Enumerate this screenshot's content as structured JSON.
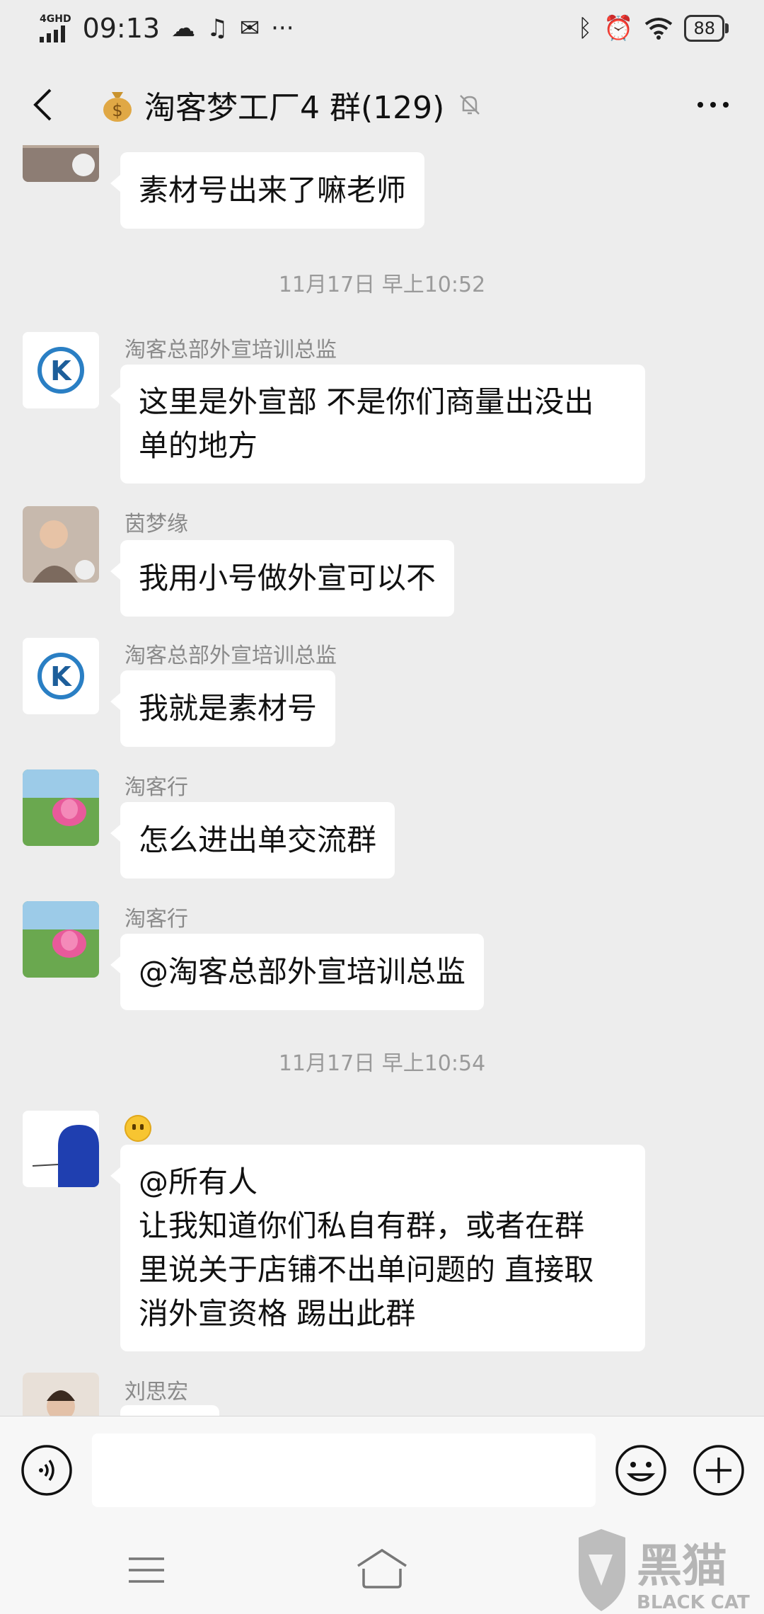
{
  "status_bar": {
    "network": "4GHD",
    "time": "09:13",
    "battery": "88"
  },
  "header": {
    "title": "淘客梦工厂4 群(129)"
  },
  "chat": {
    "partial_message": "素材号出来了嘛老师",
    "timestamp_1": "11月17日 早上10:52",
    "messages": [
      {
        "sender": "淘客总部外宣培训总监",
        "text": "这里是外宣部 不是你们商量出没出\n单的地方"
      },
      {
        "sender": "茵梦缘",
        "text": "我用小号做外宣可以不"
      },
      {
        "sender": "淘客总部外宣培训总监",
        "text": "我就是素材号"
      },
      {
        "sender": "淘客行",
        "text": "怎么进出单交流群"
      },
      {
        "sender": "淘客行",
        "text": "@淘客总部外宣培训总监"
      }
    ],
    "timestamp_2": "11月17日 早上10:54",
    "announcement": {
      "text": "@所有人\n让我知道你们私自有群，或者在群\n里说关于店铺不出单问题的 直接取\n消外宣资格 踢出此群"
    },
    "last_sender": "刘思宏"
  },
  "watermark": {
    "cn": "黑猫",
    "en": "BLACK CAT"
  },
  "icons": [
    "back-arrow-icon",
    "money-bag-icon",
    "mute-bell-icon",
    "more-dots-icon",
    "voice-icon",
    "emoji-icon",
    "plus-icon",
    "menu-icon",
    "home-icon"
  ]
}
